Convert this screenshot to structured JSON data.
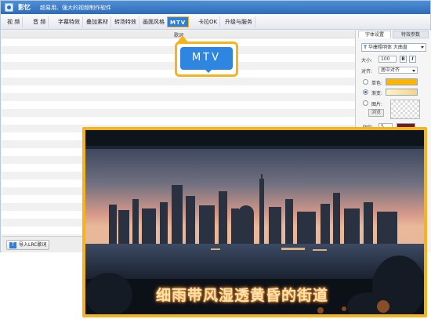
{
  "app": {
    "name": "影忆",
    "slogan": "超易用、强大的视频制作软件"
  },
  "toolbar": {
    "tabs": [
      {
        "label": "视  频"
      },
      {
        "label": "音  频"
      },
      {
        "label": "字幕特效"
      },
      {
        "label": "叠加素材"
      },
      {
        "label": "转场特效"
      },
      {
        "label": "画面风格"
      },
      {
        "label": "MTV",
        "active": true
      },
      {
        "label": "卡拉OK"
      },
      {
        "label": "升级与服务"
      }
    ]
  },
  "lyrics": {
    "header": "歌词",
    "import_button": "导入LRC歌词"
  },
  "panel": {
    "tab_font": "字体设置",
    "tab_effect": "特效参数",
    "font_name": "华康粗明体 大曲直",
    "font_glyph": "T",
    "size_label": "大小:",
    "size_value": "100",
    "bold": "B",
    "italic": "I",
    "align_label": "对齐:",
    "align_value": "居中对齐",
    "solid_label": "单色:",
    "gradient_label": "渐变:",
    "image_label": "图片:",
    "browse_label": "浏览",
    "shadow_label": "阴影:",
    "shadow_value": "5",
    "colors": {
      "solid": "#ffb400",
      "gradient_start": "#fff3c8",
      "gradient_end": "#f6d38a",
      "shadow": "#6b1f1f"
    }
  },
  "callout": {
    "label": "MTV"
  },
  "preview": {
    "subtitle": "细雨带风湿透黄昏的街道"
  },
  "accent": "#2f7fd8",
  "highlight": "#f5b41e"
}
